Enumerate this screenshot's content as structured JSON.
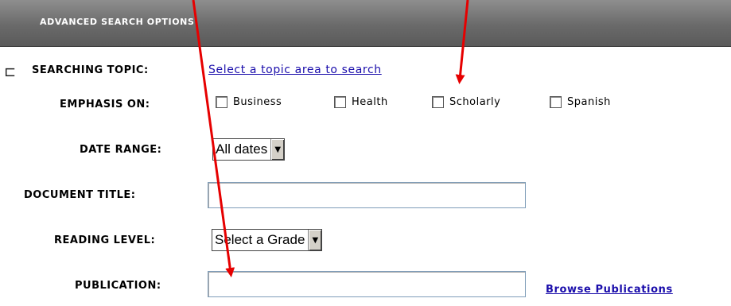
{
  "header": {
    "title": "ADVANCED SEARCH OPTIONS"
  },
  "topic": {
    "label": "SEARCHING TOPIC:",
    "link": "Select a topic area to search"
  },
  "emphasis": {
    "label": "EMPHASIS ON:",
    "options": [
      {
        "label": "Business",
        "checked": false
      },
      {
        "label": "Health",
        "checked": false
      },
      {
        "label": "Scholarly",
        "checked": false
      },
      {
        "label": "Spanish",
        "checked": false
      }
    ]
  },
  "date_range": {
    "label": "DATE RANGE:",
    "value": "All dates"
  },
  "document_title": {
    "label": "DOCUMENT TITLE:",
    "value": ""
  },
  "reading_level": {
    "label": "READING LEVEL:",
    "value": "Select a Grade"
  },
  "publication": {
    "label": "PUBLICATION:",
    "value": "",
    "browse_link": "Browse Publications"
  },
  "colors": {
    "annotation_arrow": "#e60000",
    "link": "#1a0dab"
  }
}
